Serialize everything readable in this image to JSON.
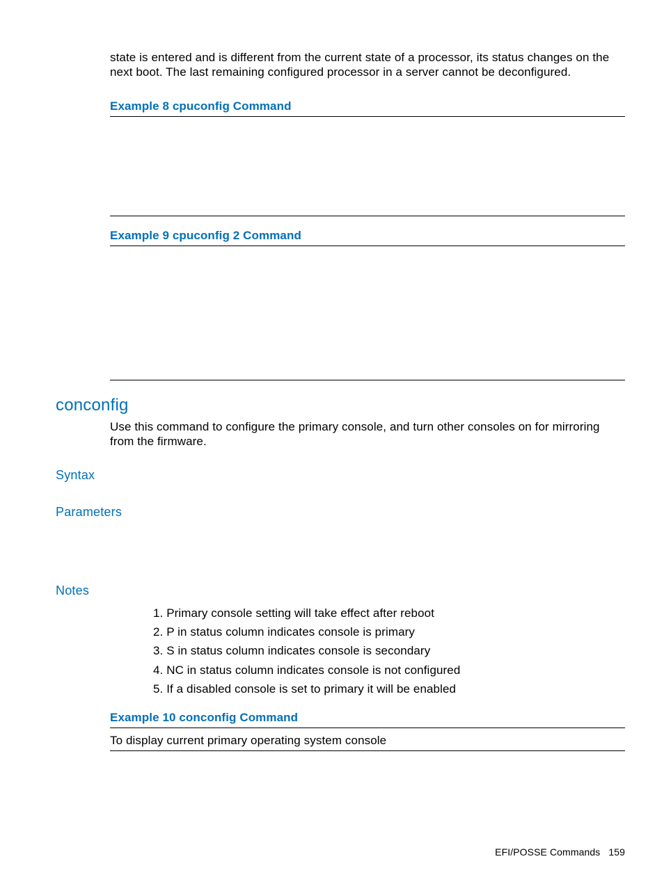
{
  "intro_para": "state is entered and is different from the current state of a processor, its status changes on the next boot. The last remaining configured processor in a server cannot be deconfigured.",
  "examples": {
    "ex8_title": "Example 8 cpuconfig Command",
    "ex9_title": "Example 9 cpuconfig 2 Command",
    "ex10_title": "Example 10 conconfig Command",
    "ex10_desc": "To display current primary operating system console"
  },
  "section": {
    "title": "conconfig",
    "desc": "Use this command to configure the primary console, and turn other consoles on for mirroring from the firmware.",
    "syntax_heading": "Syntax",
    "params_heading": "Parameters",
    "notes_heading": "Notes"
  },
  "notes": [
    "Primary console setting will take effect after reboot",
    "P in status column indicates console is primary",
    "S in status column indicates console is secondary",
    "NC in status column indicates console is not configured",
    "If a disabled console is set to primary it will be enabled"
  ],
  "footer": {
    "label": "EFI/POSSE Commands",
    "page": "159"
  }
}
